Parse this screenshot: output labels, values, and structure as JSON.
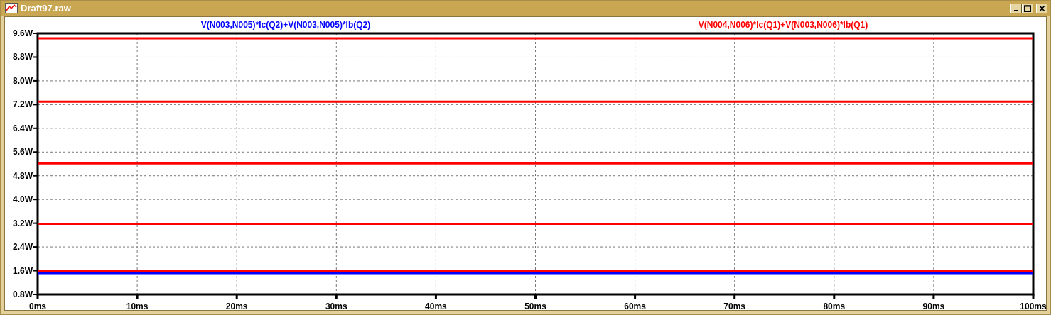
{
  "window": {
    "title": "Draft97.raw"
  },
  "plot": {
    "trace_labels": [
      {
        "text": "V(N003,N005)*Ic(Q2)+V(N003,N005)*Ib(Q2)",
        "color": "#0000ff"
      },
      {
        "text": "V(N004,N006)*Ic(Q1)+V(N003,N006)*Ib(Q1)",
        "color": "#ff0000"
      }
    ],
    "chart_data": {
      "type": "line",
      "grid": true,
      "x": [
        0,
        100
      ],
      "xlim": [
        0,
        100
      ],
      "ylim": [
        0.8,
        9.6
      ],
      "xticks": [
        {
          "value": 0,
          "label": "0ms"
        },
        {
          "value": 10,
          "label": "10ms"
        },
        {
          "value": 20,
          "label": "20ms"
        },
        {
          "value": 30,
          "label": "30ms"
        },
        {
          "value": 40,
          "label": "40ms"
        },
        {
          "value": 50,
          "label": "50ms"
        },
        {
          "value": 60,
          "label": "60ms"
        },
        {
          "value": 70,
          "label": "70ms"
        },
        {
          "value": 80,
          "label": "80ms"
        },
        {
          "value": 90,
          "label": "90ms"
        },
        {
          "value": 100,
          "label": "100ms"
        }
      ],
      "yticks": [
        {
          "value": 0.8,
          "label": "0.8W"
        },
        {
          "value": 1.6,
          "label": "1.6W"
        },
        {
          "value": 2.4,
          "label": "2.4W"
        },
        {
          "value": 3.2,
          "label": "3.2W"
        },
        {
          "value": 4.0,
          "label": "4.0W"
        },
        {
          "value": 4.8,
          "label": "4.8W"
        },
        {
          "value": 5.6,
          "label": "5.6W"
        },
        {
          "value": 6.4,
          "label": "6.4W"
        },
        {
          "value": 7.2,
          "label": "7.2W"
        },
        {
          "value": 8.0,
          "label": "8.0W"
        },
        {
          "value": 8.8,
          "label": "8.8W"
        },
        {
          "value": 9.6,
          "label": "9.6W"
        }
      ],
      "series": [
        {
          "color": "#0000ff",
          "values": [
            1.52,
            1.52
          ]
        },
        {
          "color": "#ff0000",
          "values": [
            1.59,
            1.59
          ]
        },
        {
          "color": "#ff0000",
          "values": [
            3.18,
            3.18
          ]
        },
        {
          "color": "#ff0000",
          "values": [
            5.22,
            5.22
          ]
        },
        {
          "color": "#ff0000",
          "values": [
            7.3,
            7.3
          ]
        },
        {
          "color": "#ff0000",
          "values": [
            9.43,
            9.43
          ]
        }
      ]
    }
  }
}
